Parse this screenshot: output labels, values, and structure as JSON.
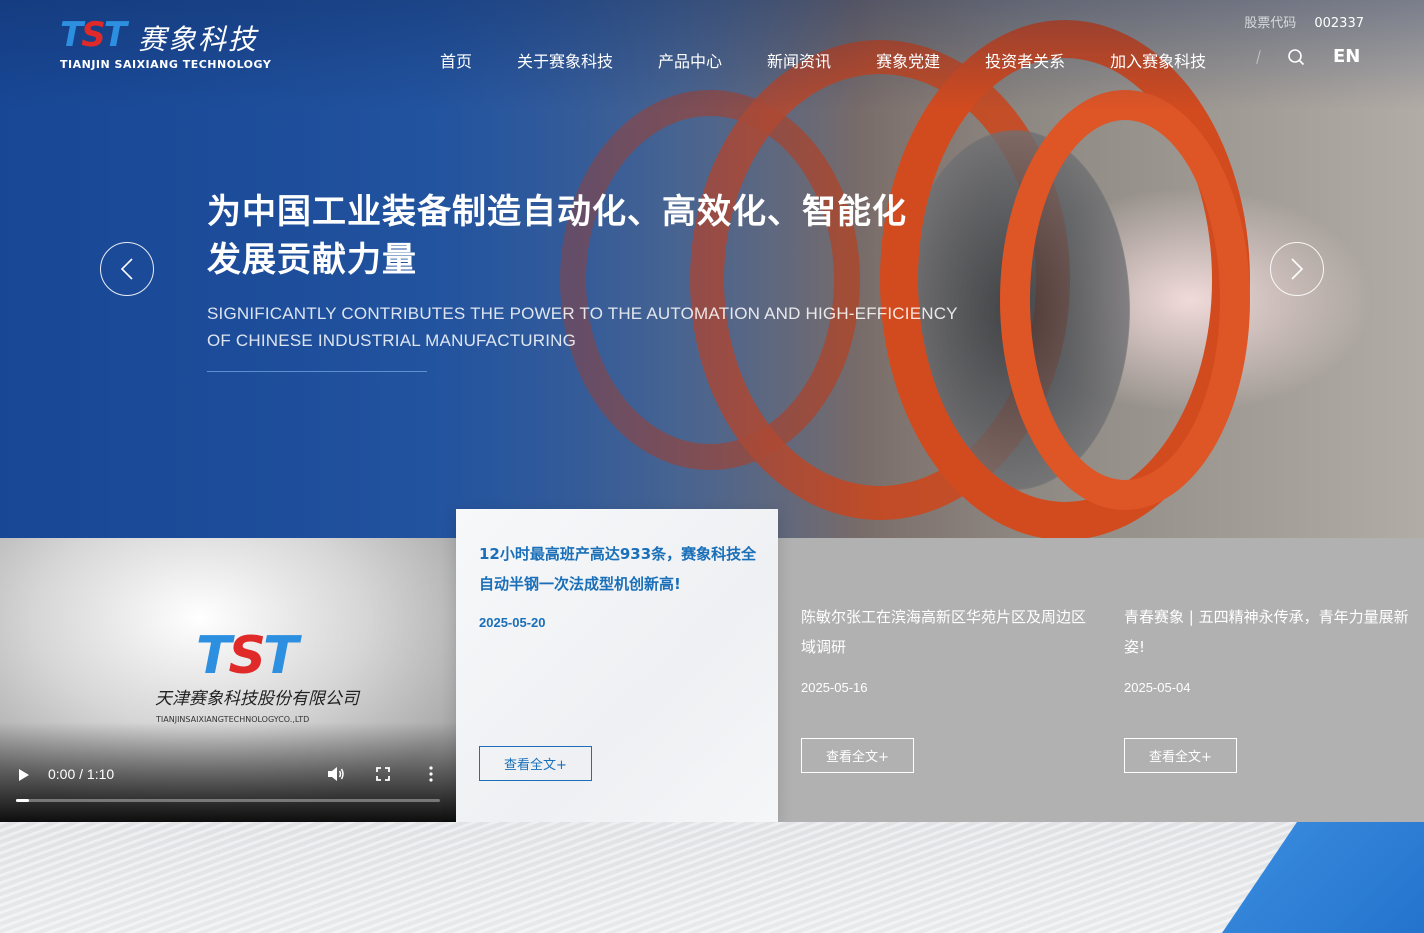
{
  "header": {
    "logo": {
      "mark": "TST",
      "name_cn": "赛象科技",
      "name_en": "TIANJIN SAIXIANG TECHNOLOGY"
    },
    "stock": {
      "label": "股票代码",
      "code": "002337"
    },
    "nav": [
      "首页",
      "关于赛象科技",
      "产品中心",
      "新闻资讯",
      "赛象党建",
      "投资者关系",
      "加入赛象科技"
    ],
    "lang": "EN"
  },
  "hero": {
    "headline_line1": "为中国工业装备制造自动化、高效化、智能化",
    "headline_line2": "发展贡献力量",
    "sub_line1": "SIGNIFICANTLY CONTRIBUTES THE POWER TO THE AUTOMATION AND HIGH-EFFICIENCY",
    "sub_line2": "OF CHINESE INDUSTRIAL MANUFACTURING"
  },
  "video": {
    "logo_mark": "TST",
    "company_cn": "天津赛象科技股份有限公司",
    "company_en": "TIANJINSAIXIANGTECHNOLOGYCO.,LTD",
    "time": "0:00 / 1:10",
    "progress": 0.03
  },
  "news": {
    "featured": {
      "title": "12小时最高班产高达933条，赛象科技全自动半钢一次法成型机创新高!",
      "date": "2025-05-20",
      "button": "查看全文+"
    },
    "items": [
      {
        "title": "陈敏尔张工在滨海高新区华苑片区及周边区域调研",
        "date": "2025-05-16",
        "button": "查看全文+"
      },
      {
        "title": "青春赛象 | 五四精神永传承，青年力量展新姿!",
        "date": "2025-05-04",
        "button": "查看全文+"
      }
    ]
  },
  "colors": {
    "brand_blue": "#1a6fb8",
    "logo_blue": "#2d8fe0",
    "logo_red": "#e02a2a",
    "accent_blue": "#2f7fd6"
  }
}
